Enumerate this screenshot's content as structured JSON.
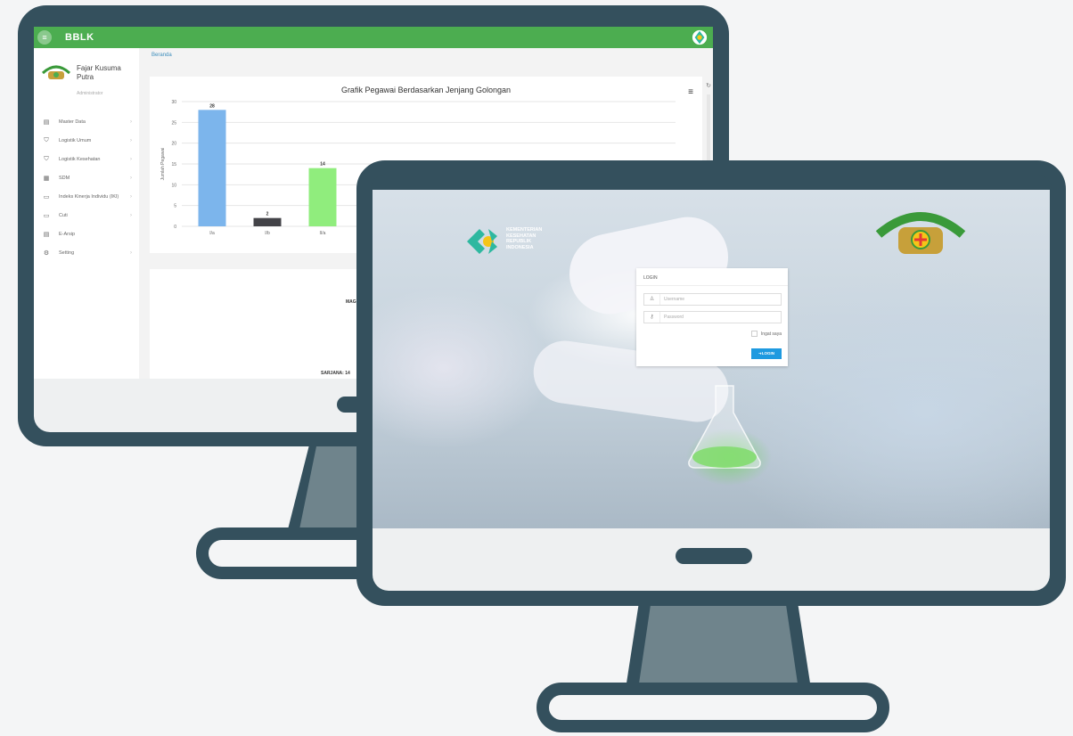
{
  "dashboard": {
    "app_title": "BBLK",
    "menu_icon": "hamburger-icon",
    "profile": {
      "name": "Fajar Kusuma Putra",
      "role": "Administrator"
    },
    "nav": [
      {
        "label": "Master Data",
        "icon": "database-icon"
      },
      {
        "label": "Logistik Umum",
        "icon": "box-icon"
      },
      {
        "label": "Logistik Kesehatan",
        "icon": "medical-box-icon"
      },
      {
        "label": "SDM",
        "icon": "people-icon"
      },
      {
        "label": "Indeks Kinerja Individu (IKI)",
        "icon": "calendar-icon"
      },
      {
        "label": "Cuti",
        "icon": "calendar-icon"
      },
      {
        "label": "E-Arsip",
        "icon": "archive-icon"
      },
      {
        "label": "Setting",
        "icon": "gear-icon"
      }
    ],
    "breadcrumb": "Beranda",
    "pie_labels": {
      "top": "MAG",
      "bottom": "SARJANA: 14"
    }
  },
  "chart_data": {
    "type": "bar",
    "title": "Grafik Pegawai Berdasarkan Jenjang Golongan",
    "ylabel": "Jumlah Pegawai",
    "xlabel": "",
    "ylim": [
      0,
      30
    ],
    "yticks": [
      0,
      5,
      10,
      15,
      20,
      25,
      30
    ],
    "categories": [
      "I/a",
      "I/b",
      "II/a"
    ],
    "values": [
      28,
      2,
      14
    ],
    "colors": [
      "#7cb5ec",
      "#434348",
      "#90ed7d"
    ]
  },
  "login": {
    "kemkes_text": [
      "KEMENTERIAN",
      "KESEHATAN",
      "REPUBLIK",
      "INDONESIA"
    ],
    "header": "LOGIN",
    "username_placeholder": "Username",
    "password_placeholder": "Password",
    "remember_label": "Ingat saya",
    "button_label": "LOGIN"
  }
}
